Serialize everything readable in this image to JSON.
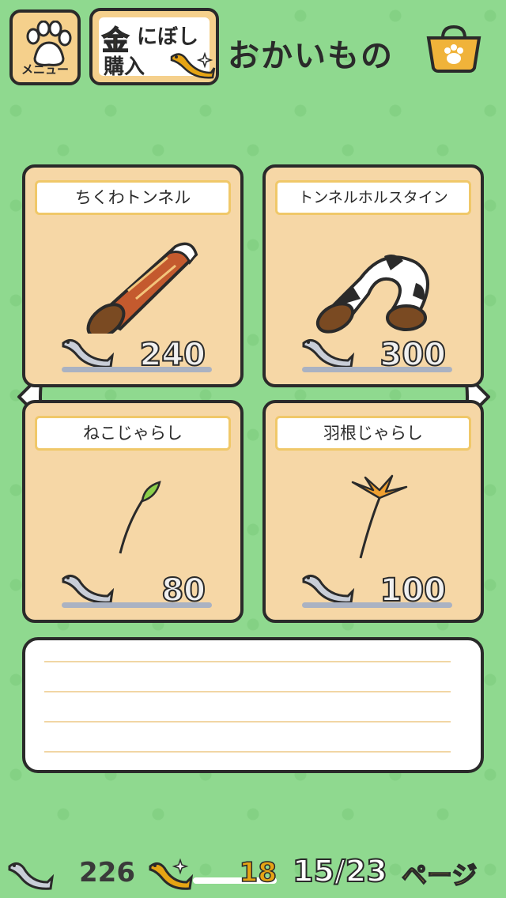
{
  "header": {
    "menu_label": "メニュー",
    "gold_kanji": "金",
    "gold_line1": "にぼし",
    "gold_line2": "購入",
    "title": "おかいもの"
  },
  "items": [
    {
      "name": "ちくわトンネル",
      "price": "240",
      "icon": "chikuwa-tunnel"
    },
    {
      "name": "トンネルホルスタイン",
      "price": "300",
      "icon": "holstein-tunnel"
    },
    {
      "name": "ねこじゃらし",
      "price": "80",
      "icon": "foxtail-toy"
    },
    {
      "name": "羽根じゃらし",
      "price": "100",
      "icon": "feather-toy"
    }
  ],
  "footer": {
    "silver_count": "226",
    "gold_count": "18",
    "page": "15/23",
    "page_label": "ページ"
  },
  "colors": {
    "background": "#8fd98f",
    "card": "#f6d7a6",
    "accent_gold": "#e6a414",
    "outline": "#2a2a2a"
  }
}
